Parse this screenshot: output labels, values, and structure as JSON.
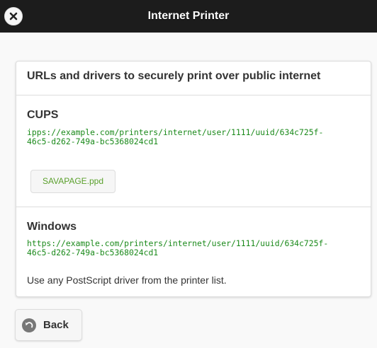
{
  "header": {
    "title": "Internet Printer",
    "close_icon": "close-icon"
  },
  "card": {
    "title": "URLs and drivers to securely print over public internet",
    "cups": {
      "heading": "CUPS",
      "url_line1": "ipps://example.com/printers/internet/user/1111/uuid/634c725f-",
      "url_line2": "46c5-d262-749a-bc5368024cd1",
      "ppd_button": "SAVAPAGE.ppd"
    },
    "windows": {
      "heading": "Windows",
      "url_line1": "https://example.com/printers/internet/user/1111/uuid/634c725f-",
      "url_line2": "46c5-d262-749a-bc5368024cd1",
      "note": "Use any PostScript driver from the printer list."
    }
  },
  "footer": {
    "back_label": "Back",
    "back_icon": "back-arrow-icon"
  },
  "colors": {
    "header_bg": "#1c1c1c",
    "url_green": "#1b8a1b",
    "ppd_green": "#5aa02c"
  }
}
